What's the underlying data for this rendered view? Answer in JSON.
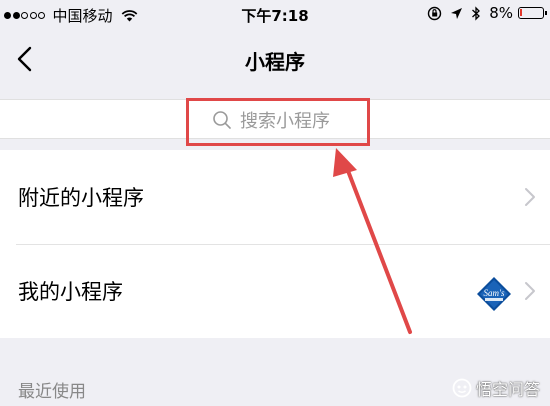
{
  "status_bar": {
    "carrier": "中国移动",
    "time": "下午7:18",
    "battery_percent": "8%",
    "battery_level": 0.08,
    "signal_bars_filled": 2,
    "signal_bars_total": 5,
    "icons": [
      "wifi-icon",
      "orientation-lock-icon",
      "location-icon",
      "bluetooth-icon",
      "battery-icon"
    ]
  },
  "nav": {
    "title": "小程序",
    "back_icon": "chevron-left-icon"
  },
  "search": {
    "placeholder": "搜索小程序",
    "icon": "search-icon"
  },
  "list": [
    {
      "label": "附近的小程序",
      "icon": "chevron-right-icon"
    },
    {
      "label": "我的小程序",
      "icon": "chevron-right-icon",
      "thumbnail": "sams-club-logo"
    }
  ],
  "section": {
    "recent_label": "最近使用"
  },
  "annotation": {
    "color": "#e04848"
  },
  "watermark": {
    "text": "悟空问答"
  },
  "colors": {
    "background": "#efeff4",
    "placeholder": "#9a9a9a",
    "annotation": "#e04848",
    "battery_low": "#e2372b"
  }
}
